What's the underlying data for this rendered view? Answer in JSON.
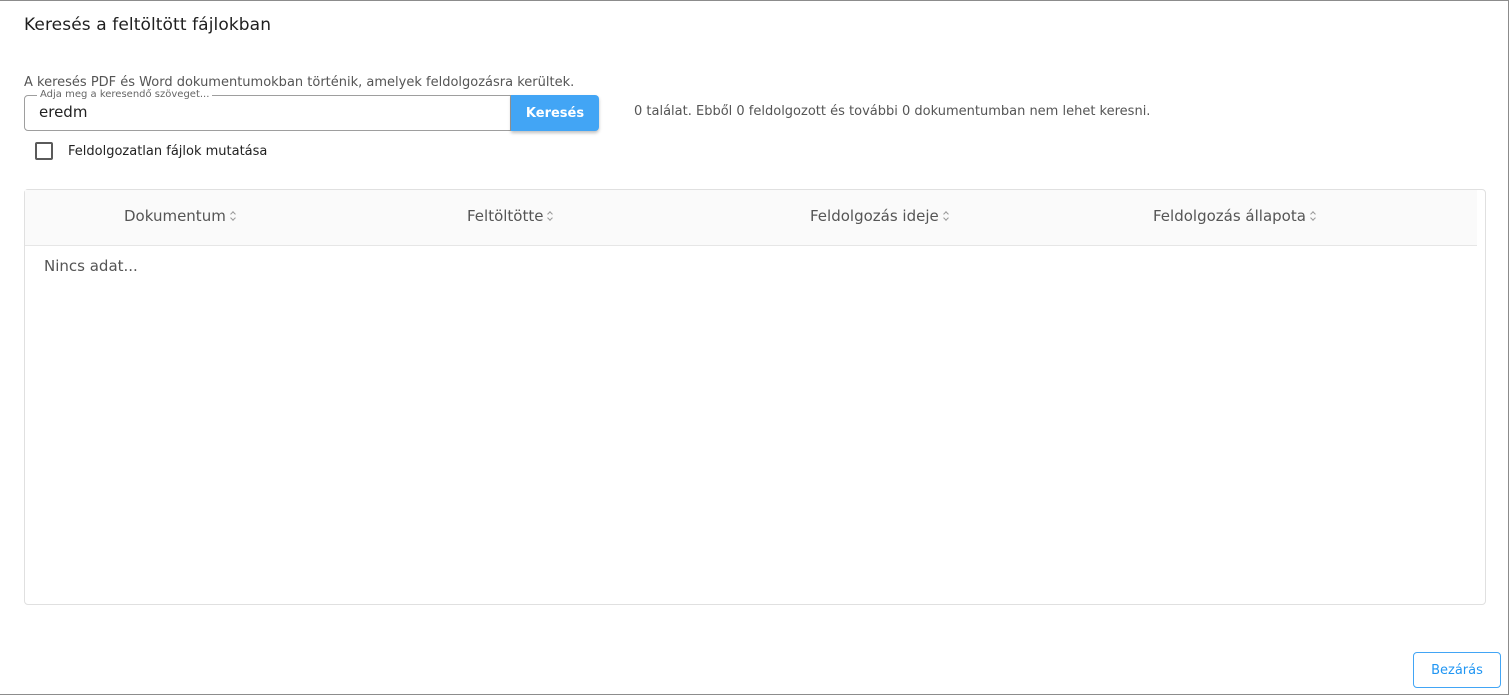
{
  "dialog": {
    "title": "Keresés a feltöltött fájlokban",
    "description": "A keresés PDF és Word dokumentumokban történik, amelyek feldolgozásra kerültek."
  },
  "search": {
    "legend": "Adja meg a keresendő szöveget...",
    "value": "eredm",
    "button_label": "Keresés",
    "result_text": "0 találat. Ebből 0 feldolgozott és további 0 dokumentumban nem lehet keresni."
  },
  "filter": {
    "checkbox_label": "Feldolgozatlan fájlok mutatása",
    "checked": false
  },
  "table": {
    "columns": [
      "Dokumentum",
      "Feltöltötte",
      "Feldolgozás ideje",
      "Feldolgozás állapota"
    ],
    "empty_text": "Nincs adat..."
  },
  "footer": {
    "close_label": "Bezárás"
  },
  "colors": {
    "accent": "#42a5f5",
    "accent_text": "#2196f3"
  }
}
